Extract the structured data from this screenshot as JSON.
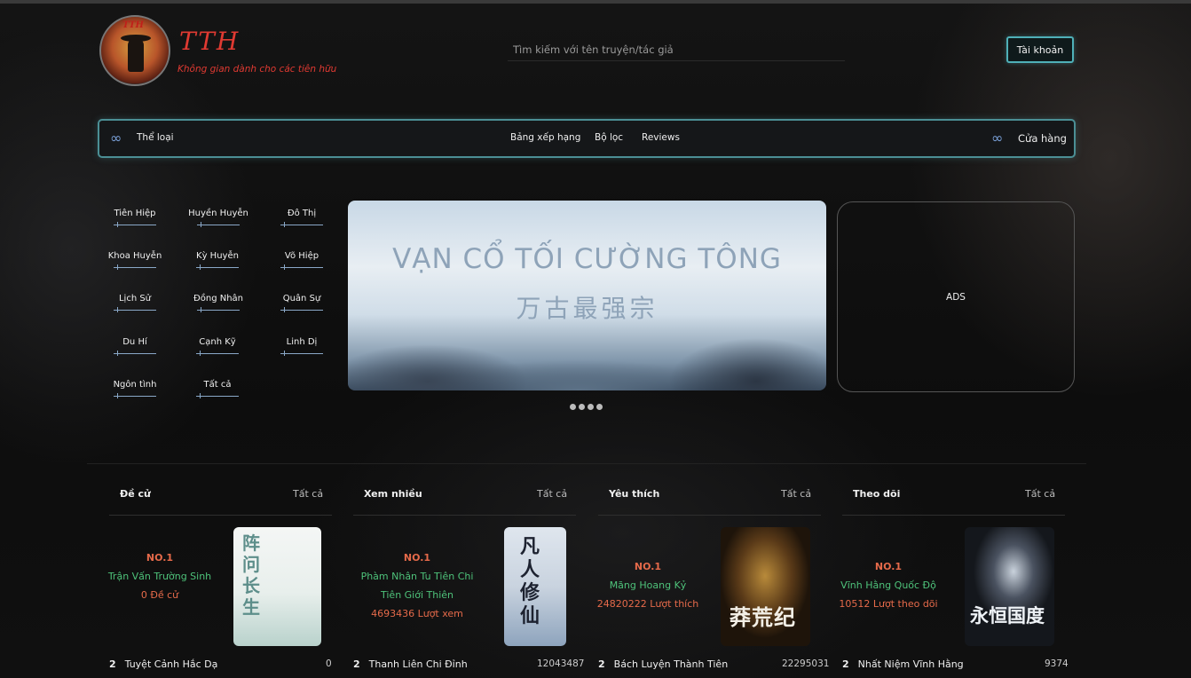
{
  "brand": {
    "name": "TTH",
    "tagline": "Không gian dành cho các tiên hữu",
    "logo_text": "TTH"
  },
  "search": {
    "placeholder": "Tìm kiếm với tên truyện/tác giả"
  },
  "account": {
    "label": "Tài khoản"
  },
  "nav": {
    "genres": "Thể loại",
    "ranking": "Bảng xếp hạng",
    "filter": "Bộ lọc",
    "reviews": "Reviews",
    "shop": "Cửa hàng"
  },
  "genres": [
    "Tiên Hiệp",
    "Huyền Huyễn",
    "Đô Thị",
    "Khoa Huyễn",
    "Kỳ Huyễn",
    "Võ Hiệp",
    "Lịch Sử",
    "Đồng Nhân",
    "Quân Sự",
    "Du Hí",
    "Cạnh Kỹ",
    "Linh Dị",
    "Ngôn tình",
    "Tất cả"
  ],
  "banner": {
    "title": "VẠN CỔ TỐI CƯỜNG TÔNG",
    "subtitle": "万古最强宗",
    "slide_count": 4,
    "active_slide": 1
  },
  "ads": {
    "label": "ADS"
  },
  "columns": [
    {
      "title": "Đề cử",
      "all": "Tất cả",
      "no": "NO.1",
      "name": "Trận Vấn Trường Sinh",
      "stat": "0 Đề cử",
      "cover_text": "阵问长生",
      "rank2": "2",
      "rank2_name": "Tuyệt Cảnh Hắc Dạ",
      "rank2_count": "0"
    },
    {
      "title": "Xem nhiều",
      "all": "Tất cả",
      "no": "NO.1",
      "name": "Phàm Nhân Tu Tiên Chi Tiên Giới Thiên",
      "stat": "4693436 Lượt xem",
      "cover_text": "凡人修仙",
      "rank2": "2",
      "rank2_name": "Thanh Liên Chi Đỉnh",
      "rank2_count": "12043487"
    },
    {
      "title": "Yêu thích",
      "all": "Tất cả",
      "no": "NO.1",
      "name": "Mãng Hoang Kỷ",
      "stat": "24820222 Lượt thích",
      "cover_text": "莽荒纪",
      "rank2": "2",
      "rank2_name": "Bách Luyện Thành Tiên",
      "rank2_count": "22295031"
    },
    {
      "title": "Theo dõi",
      "all": "Tất cả",
      "no": "NO.1",
      "name": "Vĩnh Hằng Quốc Độ",
      "stat": "10512 Lượt theo dõi",
      "cover_text": "永恒国度",
      "rank2": "2",
      "rank2_name": "Nhất Niệm Vĩnh Hằng",
      "rank2_count": "9374"
    }
  ]
}
